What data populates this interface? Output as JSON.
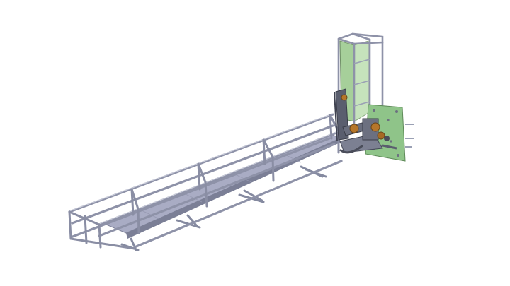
{
  "viewport": {
    "background": "#ffffff"
  },
  "model": {
    "subject": "walkway-with-guard-rails-and-lifting-mast",
    "colors": {
      "frame_steel": "#8e92a8",
      "deck_top": "#a9acc4",
      "deck_side": "#7b7f96",
      "mast_panel": "#a6cf9a",
      "mast_panel_edge": "#6f8f66",
      "mount_plate": "#8fc489",
      "bearing_amber": "#b6762a",
      "mechanism_dark": "#4a4d5a"
    }
  }
}
